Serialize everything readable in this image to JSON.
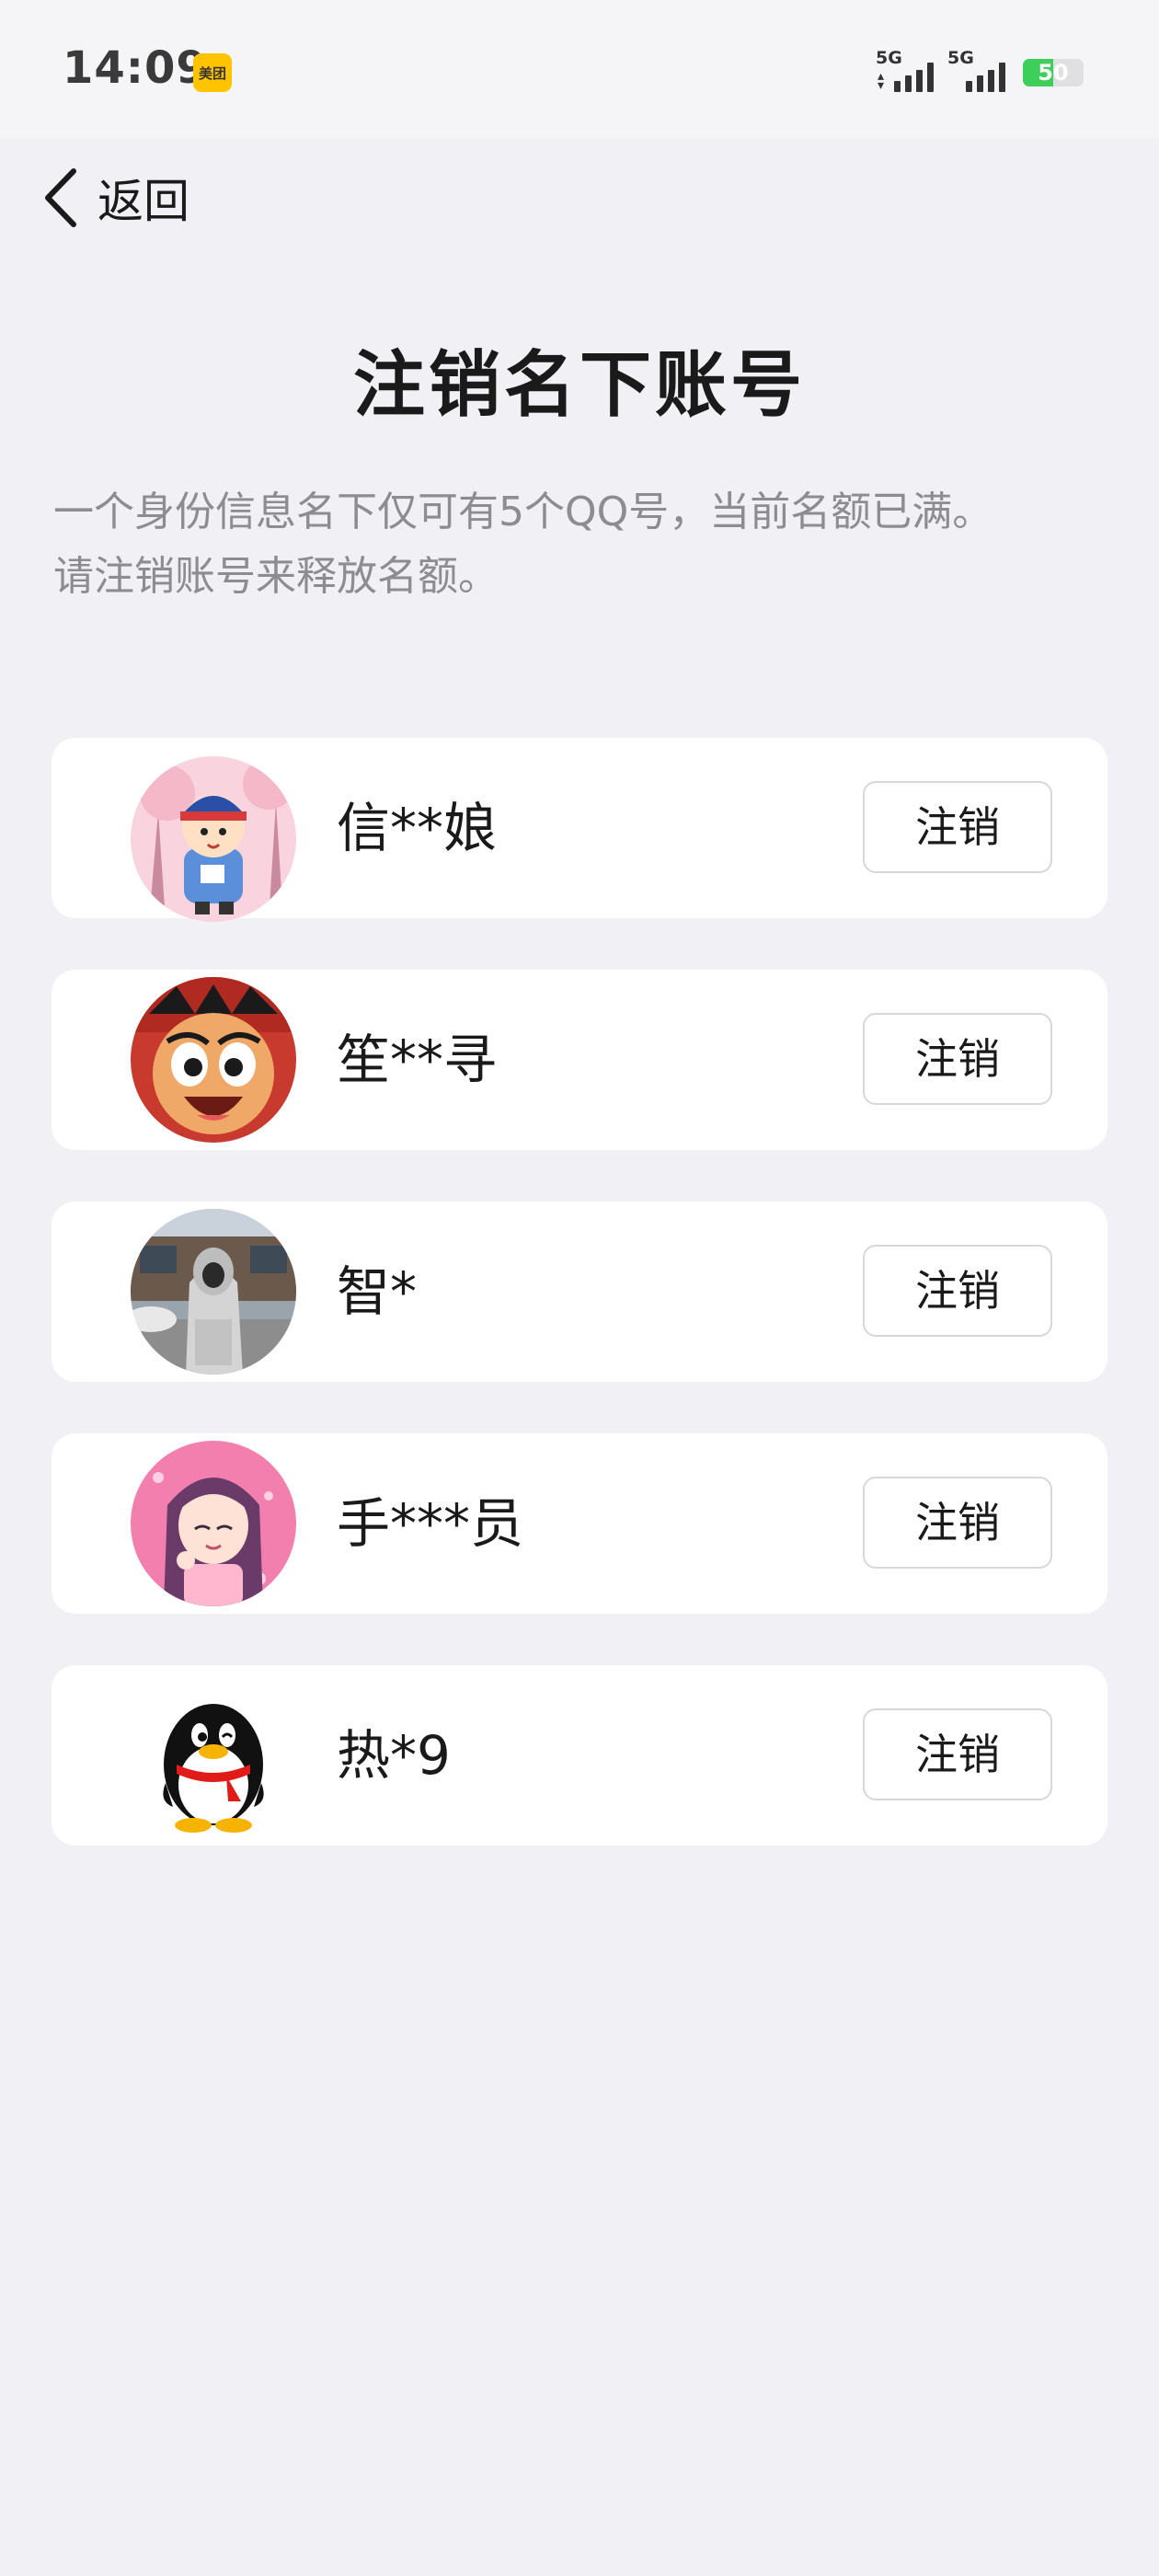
{
  "status_bar": {
    "time": "14:09",
    "app_badge": "美团",
    "signal_1": "5G",
    "signal_2": "5G",
    "battery": "50",
    "battery_level": 0.5
  },
  "nav": {
    "back_label": "返回"
  },
  "page": {
    "title": "注销名下账号",
    "description_line1": "一个身份信息名下仅可有5个QQ号，当前名额已满。",
    "description_line2": "请注销账号来释放名额。"
  },
  "accounts": [
    {
      "name": "信**娘",
      "action": "注销",
      "avatar_icon": "cartoon-kid-avatar"
    },
    {
      "name": "笙**寻",
      "action": "注销",
      "avatar_icon": "cartoon-face-avatar"
    },
    {
      "name": "智*",
      "action": "注销",
      "avatar_icon": "hooded-person-photo-avatar"
    },
    {
      "name": "手***员",
      "action": "注销",
      "avatar_icon": "anime-girl-avatar"
    },
    {
      "name": "热*9",
      "action": "注销",
      "avatar_icon": "qq-penguin-avatar"
    }
  ],
  "colors": {
    "background": "#f0f0f5",
    "card": "#ffffff",
    "secondary_text": "#8c8c91",
    "battery_green": "#3ecf5a",
    "badge_yellow": "#ffc300"
  }
}
